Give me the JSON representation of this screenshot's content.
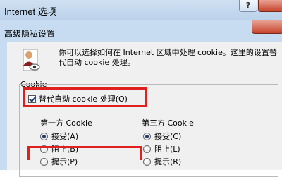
{
  "background_window": {
    "title": "Internet 选项",
    "help_label": "?"
  },
  "dialog": {
    "title": "高级隐私设置",
    "intro_text": "你可以选择如何在 Internet 区域中处理 cookie。这里的设置替代自动 cookie 处理。",
    "cookie_group_label": "Cookie",
    "override_label": "替代自动 cookie 处理(O)",
    "override_checked": true,
    "first_party": {
      "heading": "第一方 Cookie",
      "options": [
        {
          "label": "接受(A)",
          "selected": true
        },
        {
          "label": "阻止(B)",
          "selected": false
        },
        {
          "label": "提示(P)",
          "selected": false
        }
      ]
    },
    "third_party": {
      "heading": "第三方 Cookie",
      "options": [
        {
          "label": "接受(C)",
          "selected": true
        },
        {
          "label": "阻止(L)",
          "selected": false
        },
        {
          "label": "提示(R)",
          "selected": false
        }
      ]
    }
  },
  "colors": {
    "highlight": "#e0201e",
    "dialog_frame": "#c7dcf0",
    "dialog_body": "#f0f0f0"
  }
}
